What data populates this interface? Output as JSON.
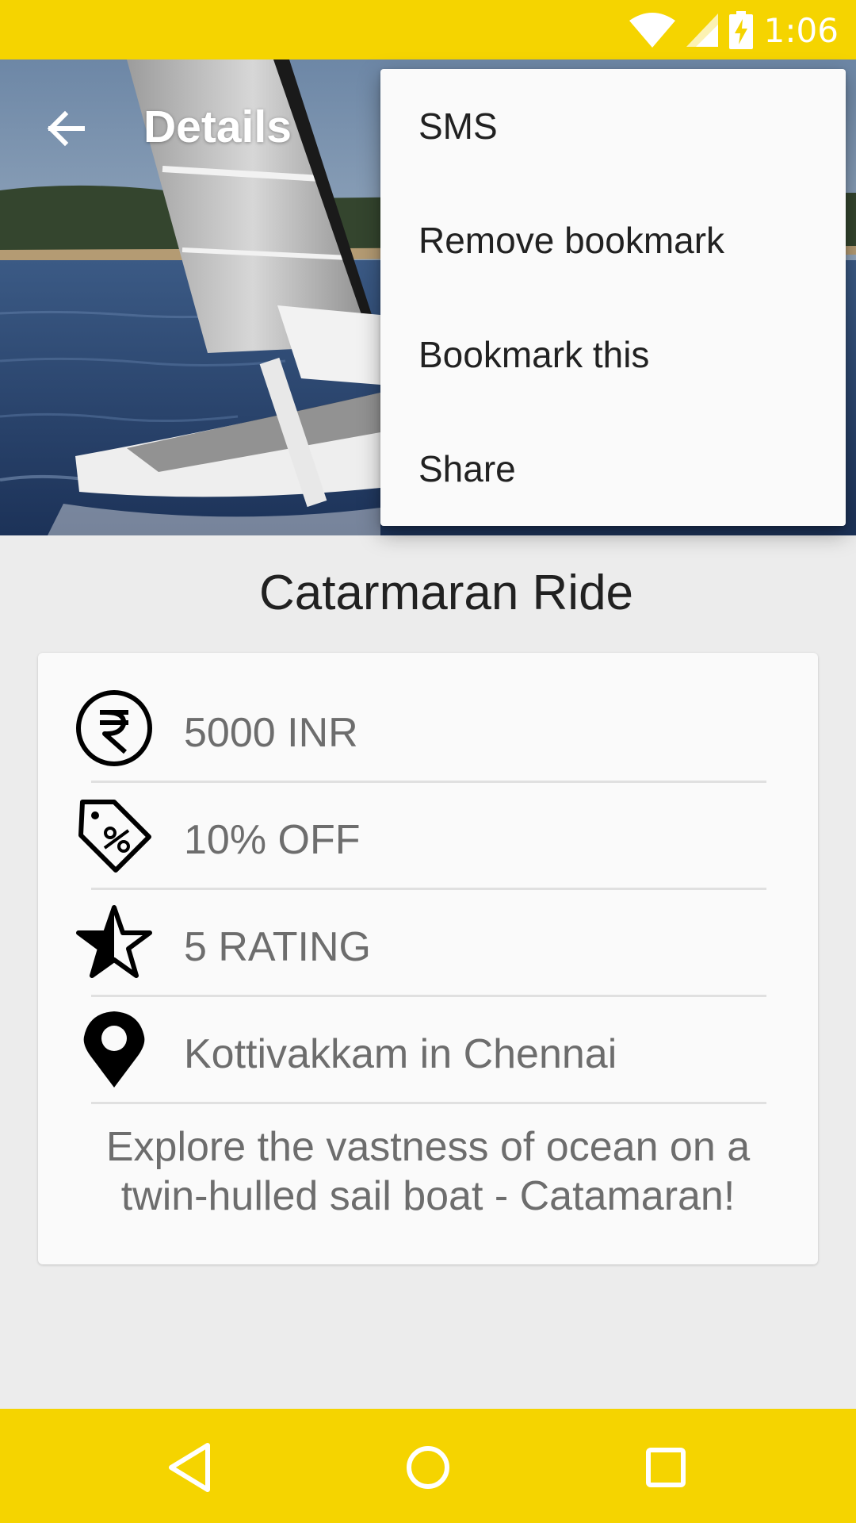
{
  "status_bar": {
    "time": "1:06",
    "icons": [
      "wifi-icon",
      "signal-icon",
      "battery-charging-icon"
    ]
  },
  "toolbar": {
    "back_icon": "arrow-back-icon",
    "title": "Details"
  },
  "overflow_menu": {
    "items": [
      {
        "label": "SMS"
      },
      {
        "label": "Remove bookmark"
      },
      {
        "label": "Bookmark this"
      },
      {
        "label": "Share"
      }
    ]
  },
  "details": {
    "title": "Catarmaran Ride",
    "price": "5000 INR",
    "price_icon": "rupee-icon",
    "discount": "10% OFF",
    "discount_icon": "discount-tag-icon",
    "rating": "5 RATING",
    "rating_icon": "star-half-icon",
    "location": "Kottivakkam in Chennai",
    "location_icon": "location-pin-icon",
    "description": "Explore the vastness of ocean on a twin-hulled sail boat - Catamaran!"
  },
  "nav_bar": {
    "icons": [
      "back-triangle-icon",
      "home-circle-icon",
      "recents-square-icon"
    ]
  },
  "colors": {
    "accent": "#f5d400",
    "menu_background": "#fafafa",
    "text_primary": "#212121",
    "text_secondary": "#6d6d6d"
  }
}
